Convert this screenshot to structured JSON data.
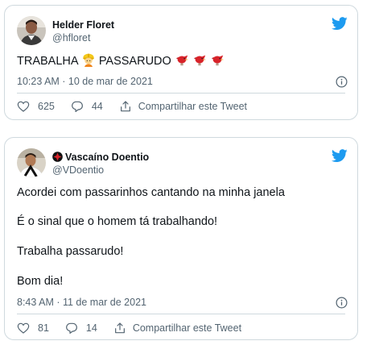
{
  "tweets": [
    {
      "author": {
        "name": "Helder Floret",
        "handle": "@hfloret"
      },
      "body_prefix": "TRABALHA",
      "body_suffix": "PASSARUDO",
      "body_lines": [],
      "emojis": [
        "construction-worker-icon",
        "red-bird-icon",
        "red-bird-icon",
        "red-bird-icon"
      ],
      "timestamp": "10:23 AM · 10 de mar de 2021",
      "likes": "625",
      "replies": "44",
      "share_label": "Compartilhar este Tweet"
    },
    {
      "author": {
        "name": "Vascaíno Doentio",
        "handle": "@VDoentio"
      },
      "body_lines": [
        "Acordei com passarinhos cantando na minha janela",
        "É o sinal que o homem tá trabalhando!",
        "Trabalha passarudo!",
        "Bom dia!"
      ],
      "timestamp": "8:43 AM · 11 de mar de 2021",
      "likes": "81",
      "replies": "14",
      "share_label": "Compartilhar este Tweet"
    }
  ],
  "colors": {
    "twitter_blue": "#1d9bf0",
    "text_primary": "#0f1419",
    "text_secondary": "#536471",
    "border": "#cfd9de",
    "bird_red": "#d8232a"
  }
}
